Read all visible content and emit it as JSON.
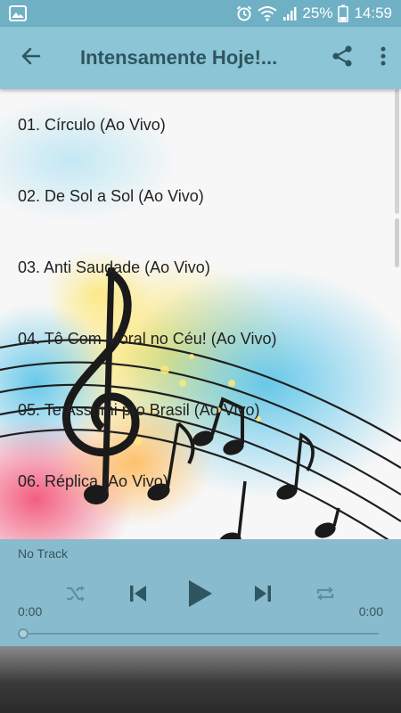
{
  "status_bar": {
    "battery_percent": "25%",
    "time": "14:59",
    "icons": [
      "image-icon",
      "alarm-icon",
      "wifi-icon",
      "signal-icon",
      "battery-icon"
    ]
  },
  "app_bar": {
    "title": "Intensamente Hoje!...",
    "icons": [
      "back-arrow-icon",
      "share-icon",
      "more-vert-icon"
    ]
  },
  "tracks": [
    "01. Círculo (Ao Vivo)",
    "02. De Sol a Sol (Ao Vivo)",
    "03. Anti Saudade (Ao Vivo)",
    "04. Tô Com Moral no Céu! (Ao Vivo)",
    "05. Te Assumi pro Brasil (Ao Vivo)",
    "06. Réplica (Ao Vivo)"
  ],
  "player": {
    "now_playing": "No Track",
    "elapsed": "0:00",
    "duration": "0:00",
    "progress": 0,
    "icons": [
      "shuffle-icon",
      "skip-previous-icon",
      "play-icon",
      "skip-next-icon",
      "repeat-icon"
    ]
  },
  "colors": {
    "status_bar": "#6fb0c4",
    "app_bar": "#8cc6d6",
    "title_text": "#2f5560",
    "player_bg": "#78b2c6"
  }
}
